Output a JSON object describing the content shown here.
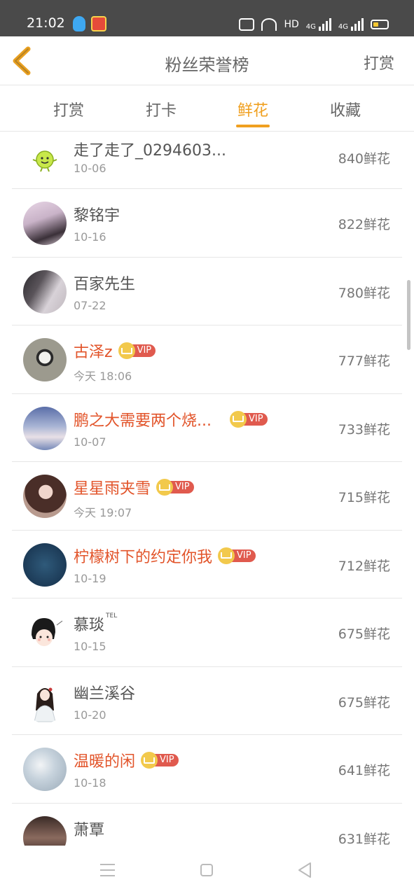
{
  "status_bar": {
    "time": "21:02",
    "net_label_1": "4G",
    "net_label_2": "4G",
    "hd_label": "HD"
  },
  "header": {
    "title": "粉丝荣誉榜",
    "action_label": "打赏"
  },
  "tabs": [
    {
      "label": "打赏",
      "active": false
    },
    {
      "label": "打卡",
      "active": false
    },
    {
      "label": "鲜花",
      "active": true
    },
    {
      "label": "收藏",
      "active": false
    }
  ],
  "vip_label": "VIP",
  "tel_label": "TEL",
  "rows": [
    {
      "name": "走了走了_0294603...",
      "date": "10-06",
      "amount": "840鲜花",
      "vip": false,
      "avatar": "smiley"
    },
    {
      "name": "黎铭宇",
      "date": "10-16",
      "amount": "822鲜花",
      "vip": false,
      "avatar": "photo"
    },
    {
      "name": "百家先生",
      "date": "07-22",
      "amount": "780鲜花",
      "vip": false,
      "avatar": "photo"
    },
    {
      "name": "古泽z",
      "date": "今天 18:06",
      "amount": "777鲜花",
      "vip": true,
      "avatar": "photo"
    },
    {
      "name": "鹏之大需要两个烧...",
      "date": "10-07",
      "amount": "733鲜花",
      "vip": true,
      "avatar": "photo"
    },
    {
      "name": "星星雨夹雪",
      "date": "今天 19:07",
      "amount": "715鲜花",
      "vip": true,
      "avatar": "photo"
    },
    {
      "name": "柠檬树下的约定你我",
      "date": "10-19",
      "amount": "712鲜花",
      "vip": true,
      "avatar": "photo"
    },
    {
      "name": "慕琰",
      "date": "10-15",
      "amount": "675鲜花",
      "vip": false,
      "avatar": "drawing"
    },
    {
      "name": "幽兰溪谷",
      "date": "10-20",
      "amount": "675鲜花",
      "vip": false,
      "avatar": "drawing"
    },
    {
      "name": "温暖的闲",
      "date": "10-18",
      "amount": "641鲜花",
      "vip": true,
      "avatar": "photo"
    },
    {
      "name": "萧覃",
      "date": "",
      "amount": "631鲜花",
      "vip": false,
      "avatar": "photo"
    }
  ],
  "colors": {
    "accent": "#f0a020",
    "vip_name": "#e2542a",
    "status_bar": "#4a4a4a"
  }
}
